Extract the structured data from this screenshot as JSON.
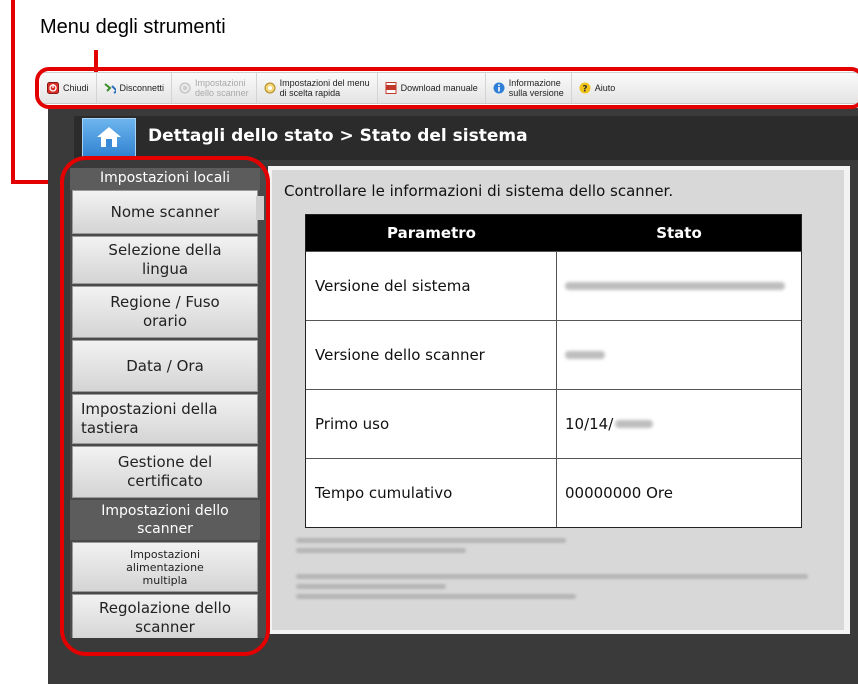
{
  "annotation": {
    "title": "Menu degli strumenti"
  },
  "toolbar": {
    "items": [
      {
        "lines": [
          "Chiudi"
        ],
        "icon": "close-icon",
        "enabled": true
      },
      {
        "lines": [
          "Disconnetti"
        ],
        "icon": "disconnect-icon",
        "enabled": true
      },
      {
        "lines": [
          "Impostazioni",
          "dello scanner"
        ],
        "icon": "gear-icon",
        "enabled": false
      },
      {
        "lines": [
          "Impostazioni del menu",
          "di scelta rapida"
        ],
        "icon": "gear-icon",
        "enabled": true
      },
      {
        "lines": [
          "Download manuale"
        ],
        "icon": "pdf-icon",
        "enabled": true
      },
      {
        "lines": [
          "Informazione",
          "sulla versione"
        ],
        "icon": "info-icon",
        "enabled": true
      },
      {
        "lines": [
          "Aiuto"
        ],
        "icon": "help-icon",
        "enabled": true
      }
    ]
  },
  "page": {
    "title": "Dettagli dello stato > Stato del sistema"
  },
  "sidebar": {
    "header_local": "Impostazioni locali",
    "nome_scanner": "Nome scanner",
    "lingua": "Selezione della\nlingua",
    "regione": "Regione / Fuso\norario",
    "data_ora": "Data / Ora",
    "tastiera": "Impostazioni della\ntastiera",
    "certificato": "Gestione del\ncertificato",
    "header_scanner": "Impostazioni dello\nscanner",
    "alimentazione": "Impostazioni\nalimentazione\nmultipla",
    "regolazione": "Regolazione dello\nscanner"
  },
  "main": {
    "intro": "Controllare le informazioni di sistema dello scanner.",
    "table": {
      "headers": [
        "Parametro",
        "Stato"
      ],
      "rows": [
        {
          "param": "Versione del sistema",
          "value": ""
        },
        {
          "param": "Versione dello scanner",
          "value": ""
        },
        {
          "param": "Primo uso",
          "value": "10/14/"
        },
        {
          "param": "Tempo cumulativo",
          "value": "00000000 Ore"
        }
      ]
    }
  },
  "colors": {
    "annotation": "#e30000",
    "header_bg": "#000000",
    "panel_bg": "#d8d8d8"
  }
}
